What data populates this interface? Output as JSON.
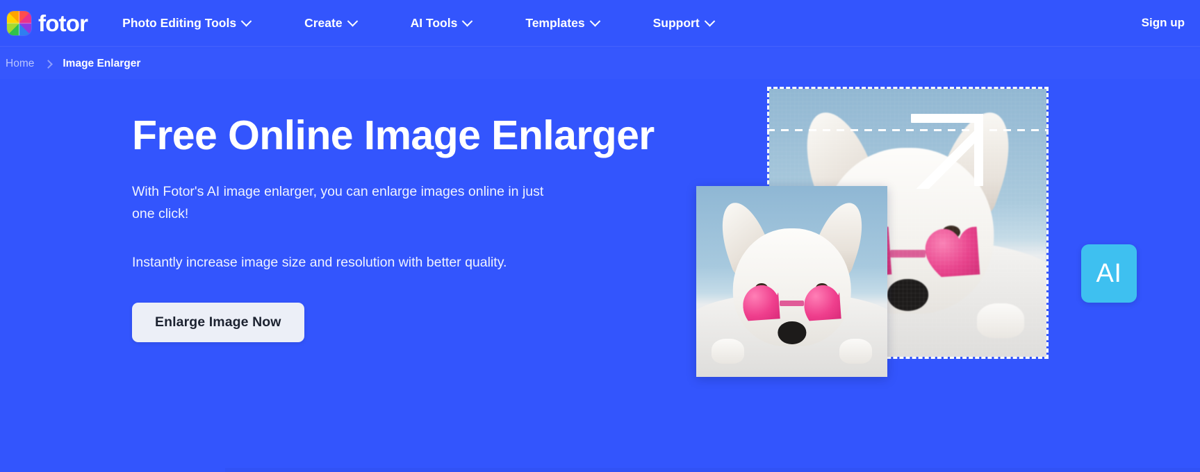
{
  "brand": {
    "name": "fotor",
    "logo_icon": "fotor-pinwheel-logo-icon"
  },
  "header": {
    "nav_items": [
      {
        "label": "Photo Editing Tools",
        "has_dropdown": true
      },
      {
        "label": "Create",
        "has_dropdown": true
      },
      {
        "label": "AI Tools",
        "has_dropdown": true
      },
      {
        "label": "Templates",
        "has_dropdown": true
      },
      {
        "label": "Support",
        "has_dropdown": true
      }
    ],
    "signup_label": "Sign up"
  },
  "breadcrumb": {
    "home_label": "Home",
    "separator_icon": "chevron-right-icon",
    "current_label": "Image Enlarger"
  },
  "hero": {
    "title": "Free Online Image Enlarger",
    "lead": "With Fotor's AI image enlarger, you can enlarge images online in just one click!",
    "subtext": "Instantly increase image size and resolution with better quality.",
    "cta_label": "Enlarge Image Now"
  },
  "hero_art": {
    "ai_badge_label": "AI",
    "arrow_icon": "enlarge-arrow-up-right-icon",
    "back_photo_alt": "Blurry low-resolution photo of a white dog wearing pink heart sunglasses",
    "front_photo_alt": "Sharp enlarged photo of a white dog wearing pink heart sunglasses",
    "selection_icon": "dashed-selection-marquee-icon"
  },
  "colors": {
    "brand_blue": "#3355fd",
    "breadcrumb_blue": "#3657fd",
    "cta_background": "#eceff7",
    "cta_text": "#1c2230",
    "ai_badge": "#3ec0f0",
    "muted_text": "#b9c5fe",
    "white": "#ffffff"
  }
}
